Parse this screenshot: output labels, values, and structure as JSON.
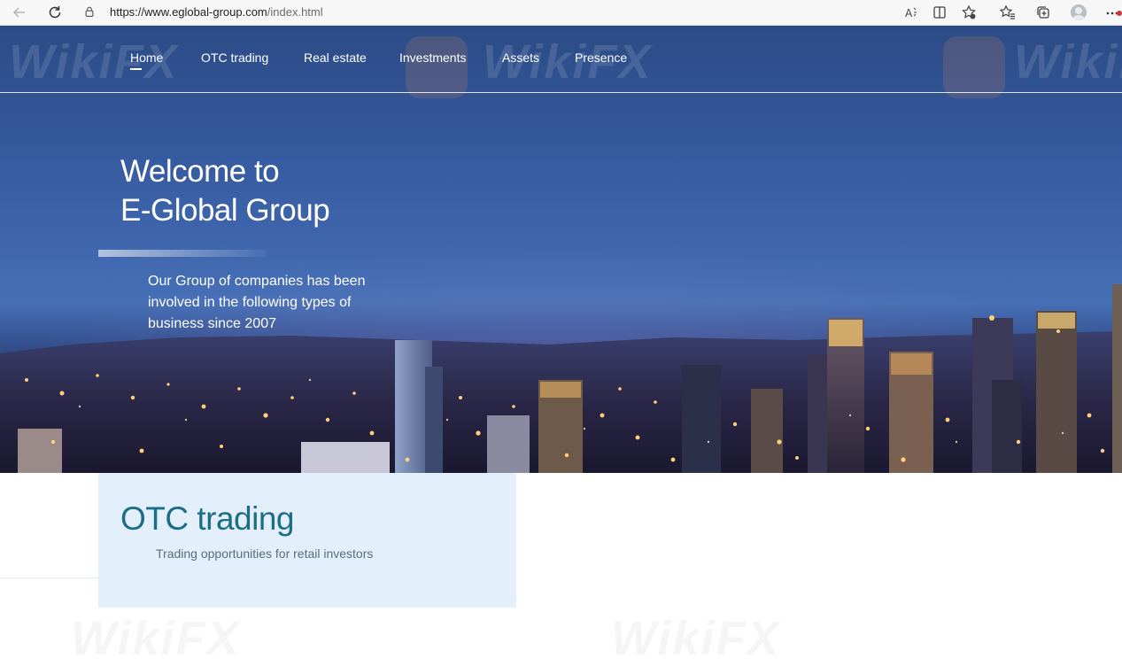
{
  "browser": {
    "url_host": "https://www.eglobal-group.com",
    "url_path": "/index.html"
  },
  "nav": {
    "items": [
      {
        "label": "Home",
        "active": true
      },
      {
        "label": "OTC trading",
        "active": false
      },
      {
        "label": "Real estate",
        "active": false
      },
      {
        "label": "Investments",
        "active": false
      },
      {
        "label": "Assets",
        "active": false
      },
      {
        "label": "Presence",
        "active": false
      }
    ]
  },
  "hero": {
    "title_line1": "Welcome to",
    "title_line2": "E-Global Group",
    "description": "Our Group of companies has been involved in the following types of business since 2007"
  },
  "otc": {
    "title": "OTC trading",
    "subtitle": "Trading opportunities for retail investors"
  },
  "colors": {
    "accent": "#1c6d86",
    "card_bg": "#e3f0fb",
    "hero_blue": "#33569a"
  },
  "icons": [
    "back-arrow-icon",
    "refresh-icon",
    "lock-icon",
    "read-aloud-icon",
    "split-screen-icon",
    "add-favorite-icon",
    "favorites-icon",
    "collections-icon",
    "profile-icon",
    "more-icon"
  ]
}
